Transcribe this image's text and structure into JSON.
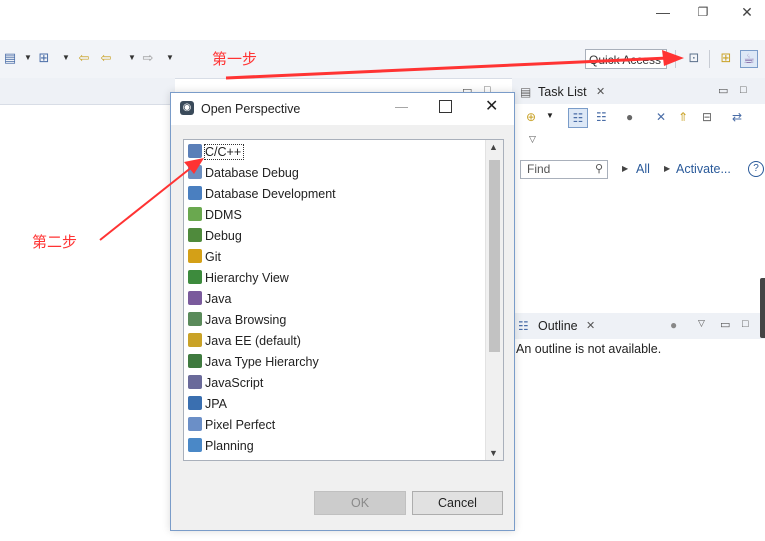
{
  "window_controls": {
    "minimize": "—",
    "restore": "❐",
    "close": "✕"
  },
  "toolbar": {
    "quick_access": "Quick Access",
    "open_perspective_icon": "open-perspective-icon",
    "perspective_icons": [
      "cpp-perspective-icon",
      "java-perspective-icon"
    ]
  },
  "annotations": {
    "step1": "第一步",
    "step2": "第二步",
    "arrow_color": "#ff3333"
  },
  "task_list": {
    "title": "Task List",
    "find_placeholder": "Find",
    "all_label": "All",
    "activate_label": "Activate...",
    "help": "?"
  },
  "outline": {
    "title": "Outline",
    "message": "An outline is not available."
  },
  "dialog": {
    "title": "Open Perspective",
    "items": [
      {
        "label": "C/C++",
        "icon": "cpp-icon",
        "color": "#5b7fb8"
      },
      {
        "label": "Database Debug",
        "icon": "database-debug-icon",
        "color": "#6c8ebf"
      },
      {
        "label": "Database Development",
        "icon": "database-icon",
        "color": "#4a7fc0"
      },
      {
        "label": "DDMS",
        "icon": "android-icon",
        "color": "#6aa84f"
      },
      {
        "label": "Debug",
        "icon": "bug-icon",
        "color": "#4f8a3c"
      },
      {
        "label": "Git",
        "icon": "git-icon",
        "color": "#d4a017"
      },
      {
        "label": "Hierarchy View",
        "icon": "hierarchy-icon",
        "color": "#3d8b3d"
      },
      {
        "label": "Java",
        "icon": "java-icon",
        "color": "#7a5a9c"
      },
      {
        "label": "Java Browsing",
        "icon": "java-browsing-icon",
        "color": "#5a8a5a"
      },
      {
        "label": "Java EE (default)",
        "icon": "java-ee-icon",
        "color": "#c9a227"
      },
      {
        "label": "Java Type Hierarchy",
        "icon": "type-hierarchy-icon",
        "color": "#3f7a3f"
      },
      {
        "label": "JavaScript",
        "icon": "javascript-icon",
        "color": "#6a6a9a"
      },
      {
        "label": "JPA",
        "icon": "jpa-icon",
        "color": "#3a6fb0"
      },
      {
        "label": "Pixel Perfect",
        "icon": "magnifier-icon",
        "color": "#6b8fc7"
      },
      {
        "label": "Planning",
        "icon": "planning-icon",
        "color": "#4a88c7"
      }
    ],
    "ok_label": "OK",
    "cancel_label": "Cancel"
  }
}
